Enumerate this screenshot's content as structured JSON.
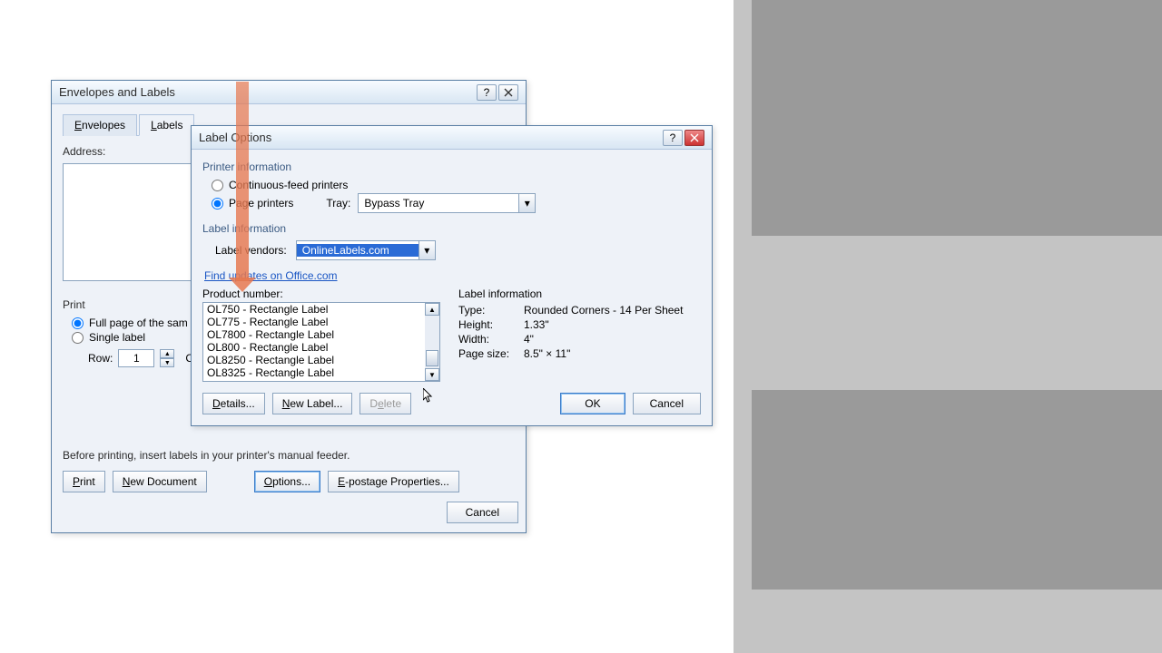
{
  "background_dialog": {
    "title": "Envelopes and Labels",
    "tabs": {
      "envelopes": "Envelopes",
      "labels": "Labels"
    },
    "address_label": "Address:",
    "print_group": "Print",
    "full_page": "Full page of the sam",
    "single_label": "Single label",
    "row_label": "Row:",
    "row_value": "1",
    "note": "Before printing, insert labels in your printer's manual feeder.",
    "print_btn": "Print",
    "new_doc_btn": "New Document",
    "options_btn": "Options...",
    "epostage_btn": "E-postage Properties...",
    "cancel_btn": "Cancel"
  },
  "options_dialog": {
    "title": "Label Options",
    "printer_info": "Printer information",
    "continuous": "Continuous-feed printers",
    "page_printers": "Page printers",
    "tray_label": "Tray:",
    "tray_value": "Bypass Tray",
    "label_info": "Label information",
    "vendors_label": "Label vendors:",
    "vendor_value": "OnlineLabels.com",
    "find_updates": "Find updates on Office.com",
    "product_label": "Product number:",
    "products": [
      "OL750 - Rectangle Label",
      "OL775 - Rectangle Label",
      "OL7800 - Rectangle Label",
      "OL800 - Rectangle Label",
      "OL8250 - Rectangle Label",
      "OL8325 - Rectangle Label"
    ],
    "info_title": "Label information",
    "info": {
      "type_k": "Type:",
      "type_v": "Rounded Corners - 14 Per Sheet",
      "height_k": "Height:",
      "height_v": "1.33\"",
      "width_k": "Width:",
      "width_v": "4\"",
      "psize_k": "Page size:",
      "psize_v": "8.5\" × 11\""
    },
    "details_btn": "Details...",
    "newlabel_btn": "New Label...",
    "delete_btn": "Delete",
    "ok_btn": "OK",
    "cancel_btn": "Cancel"
  }
}
